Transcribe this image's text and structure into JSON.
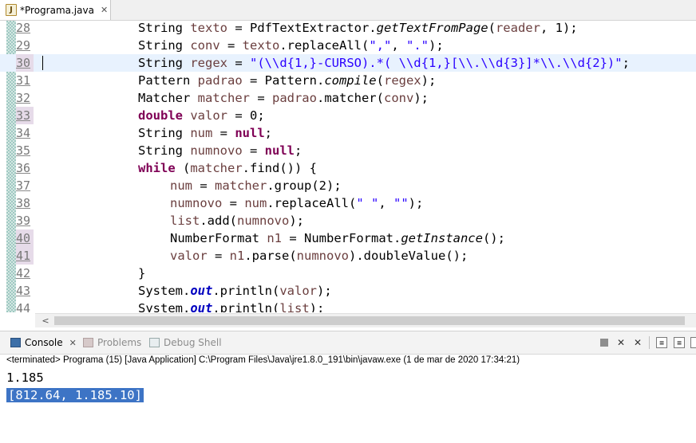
{
  "editor": {
    "tab_icon": "J",
    "tab_title": "*Programa.java",
    "close_glyph": "✕"
  },
  "code": {
    "lines": [
      {
        "num": "28"
      },
      {
        "num": "29"
      },
      {
        "num": "30"
      },
      {
        "num": "31"
      },
      {
        "num": "32"
      },
      {
        "num": "33"
      },
      {
        "num": "34"
      },
      {
        "num": "35"
      },
      {
        "num": "36"
      },
      {
        "num": "37"
      },
      {
        "num": "38"
      },
      {
        "num": "39"
      },
      {
        "num": "40"
      },
      {
        "num": "41"
      },
      {
        "num": "42"
      },
      {
        "num": "43"
      },
      {
        "num": "44"
      }
    ],
    "tokens": {
      "l28": [
        "String ",
        "texto",
        " = PdfTextExtractor.",
        "getTextFromPage",
        "(",
        "reader",
        ", 1);"
      ],
      "l29": [
        "String ",
        "conv",
        " = ",
        "texto",
        ".replaceAll(",
        "\",\"",
        ", ",
        "\".\"",
        ");"
      ],
      "l30": [
        "String ",
        "regex",
        " = ",
        "\"(\\\\d{1,}-CURSO).*( \\\\d{1,}[\\\\.\\\\d{3}]*\\\\.\\\\d{2})\"",
        ";"
      ],
      "l31": [
        "Pattern ",
        "padrao",
        " = Pattern.",
        "compile",
        "(",
        "regex",
        ");"
      ],
      "l32": [
        "Matcher ",
        "matcher",
        " = ",
        "padrao",
        ".matcher(",
        "conv",
        ");"
      ],
      "l33": [
        "double",
        " ",
        "valor",
        " = 0;"
      ],
      "l34": [
        "String ",
        "num",
        " = ",
        "null",
        ";"
      ],
      "l35": [
        "String ",
        "numnovo",
        " = ",
        "null",
        ";"
      ],
      "l36": [
        "while",
        " (",
        "matcher",
        ".find()) {"
      ],
      "l37": [
        "num",
        " = ",
        "matcher",
        ".group(2);"
      ],
      "l38": [
        "numnovo",
        " = ",
        "num",
        ".replaceAll(",
        "\" \"",
        ", ",
        "\"\"",
        ");"
      ],
      "l39": [
        "list",
        ".add(",
        "numnovo",
        ");"
      ],
      "l40": [
        "NumberFormat ",
        "n1",
        " = NumberFormat.",
        "getInstance",
        "();"
      ],
      "l41": [
        "valor",
        " = ",
        "n1",
        ".parse(",
        "numnovo",
        ").doubleValue();"
      ],
      "l42": [
        "}"
      ],
      "l43": [
        "System.",
        "out",
        ".println(",
        "valor",
        ");"
      ],
      "l44": [
        "System.",
        "out",
        ".println(",
        "list",
        ");"
      ]
    }
  },
  "scrollbar": {
    "left_arrow": "<"
  },
  "console": {
    "tabs": {
      "console": "Console",
      "problems": "Problems",
      "debug_shell": "Debug Shell"
    },
    "status": "<terminated> Programa (15) [Java Application] C:\\Program Files\\Java\\jre1.8.0_191\\bin\\javaw.exe (1 de mar de 2020 17:34:21)",
    "output": {
      "line1": "1.185",
      "line2": "[812.64, 1.185.10]"
    }
  },
  "colors": {
    "keyword": "#7f0055",
    "string": "#2a00ff",
    "static_field": "#0000c0",
    "local_variable": "#6a3e3e",
    "current_line": "#e8f2fe",
    "selection": "#3d74c5"
  },
  "icons": {
    "editor_tab": "java-file-icon",
    "console_tab": "console-icon",
    "problems_tab": "problems-icon",
    "debug_shell_tab": "debug-shell-icon",
    "toolbar": [
      "terminate-icon",
      "remove-launch-icon",
      "remove-all-launches-icon",
      "scroll-lock-icon",
      "word-wrap-icon",
      "pin-console-icon"
    ]
  }
}
